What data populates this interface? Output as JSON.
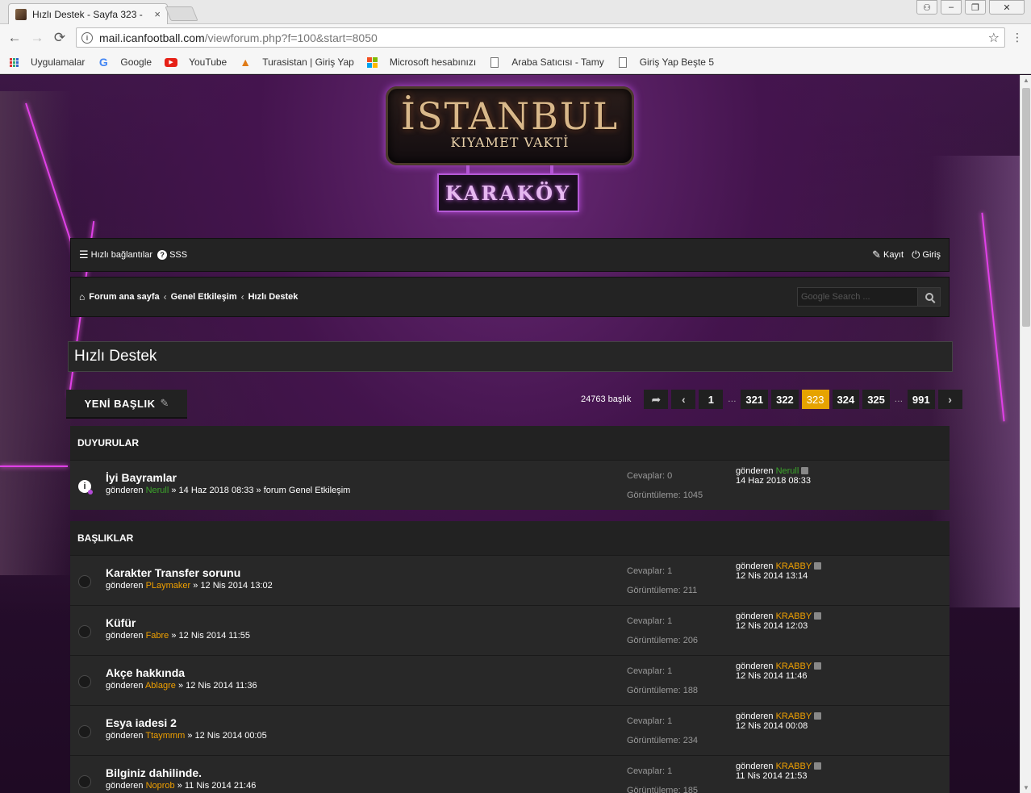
{
  "browser": {
    "tab_title": "Hızlı Destek - Sayfa 323 -",
    "tab_close": "×",
    "url_host": "mail.icanfootball.com",
    "url_path": "/viewforum.php?f=100&start=8050",
    "window_buttons": {
      "user": "⚇",
      "minimize": "–",
      "restore": "❐",
      "close": "✕"
    },
    "nav": {
      "back": "←",
      "forward": "→",
      "reload": "⟳"
    },
    "bookmarks": [
      {
        "label": "Uygulamalar",
        "icon": "apps-grid-icon"
      },
      {
        "label": "Google",
        "icon": "google-icon"
      },
      {
        "label": "YouTube",
        "icon": "youtube-icon"
      },
      {
        "label": "Turasistan | Giriş Yap",
        "icon": "turasistan-icon"
      },
      {
        "label": "Microsoft hesabınızı",
        "icon": "microsoft-icon"
      },
      {
        "label": "Araba Satıcısı - Tamy",
        "icon": "document-icon"
      },
      {
        "label": "Giriş Yap Beşte 5",
        "icon": "document-icon"
      }
    ]
  },
  "logo": {
    "title": "İSTANBUL",
    "subtitle": "KIYAMET VAKTİ",
    "plate": "KARAKÖY"
  },
  "navbar": {
    "quick_links": "Hızlı bağlantılar",
    "faq": "SSS",
    "register": "Kayıt",
    "login": "Giriş"
  },
  "breadcrumbs": {
    "home": "Forum ana sayfa",
    "items": [
      "Genel Etkileşim",
      "Hızlı Destek"
    ],
    "search_placeholder": "Google Search ..."
  },
  "forum": {
    "title": "Hızlı Destek",
    "new_topic": "YENİ BAŞLIK"
  },
  "pagination": {
    "count": "24763 başlık",
    "pages": [
      "1",
      "321",
      "322",
      "323",
      "324",
      "325",
      "991"
    ],
    "active": "323",
    "ellipsis": "…"
  },
  "announcements": {
    "heading": "DUYURULAR",
    "items": [
      {
        "title": "İyi Bayramlar",
        "by": "gönderen",
        "author": "Nerull",
        "date": "» 14 Haz 2018 08:33 » forum Genel Etkileşim",
        "replies": "Cevaplar: 0",
        "views": "Görüntüleme: 1045",
        "last_by": "gönderen",
        "last_author": "Nerull",
        "last_date": "14 Haz 2018 08:33"
      }
    ]
  },
  "topics": {
    "heading": "BAŞLIKLAR",
    "items": [
      {
        "title": "Karakter Transfer sorunu",
        "by": "gönderen",
        "author": "PLaymaker",
        "date": "» 12 Nis 2014 13:02",
        "replies": "Cevaplar: 1",
        "views": "Görüntüleme: 211",
        "last_by": "gönderen",
        "last_author": "KRABBY",
        "last_date": "12 Nis 2014 13:14"
      },
      {
        "title": "Küfür",
        "by": "gönderen",
        "author": "Fabre",
        "date": "» 12 Nis 2014 11:55",
        "replies": "Cevaplar: 1",
        "views": "Görüntüleme: 206",
        "last_by": "gönderen",
        "last_author": "KRABBY",
        "last_date": "12 Nis 2014 12:03"
      },
      {
        "title": "Akçe hakkında",
        "by": "gönderen",
        "author": "Ablagre",
        "date": "» 12 Nis 2014 11:36",
        "replies": "Cevaplar: 1",
        "views": "Görüntüleme: 188",
        "last_by": "gönderen",
        "last_author": "KRABBY",
        "last_date": "12 Nis 2014 11:46"
      },
      {
        "title": "Esya iadesi 2",
        "by": "gönderen",
        "author": "Ttaymmm",
        "date": "» 12 Nis 2014 00:05",
        "replies": "Cevaplar: 1",
        "views": "Görüntüleme: 234",
        "last_by": "gönderen",
        "last_author": "KRABBY",
        "last_date": "12 Nis 2014 00:08"
      },
      {
        "title": "Bilginiz dahilinde.",
        "by": "gönderen",
        "author": "Noprob",
        "date": "» 11 Nis 2014 21:46",
        "replies": "Cevaplar: 1",
        "views": "Görüntüleme: 185",
        "last_by": "gönderen",
        "last_author": "KRABBY",
        "last_date": "11 Nis 2014 21:53"
      }
    ]
  },
  "colors": {
    "accent_active_page": "#e6a300",
    "author_green": "#3ca52c",
    "author_orange": "#f0a000",
    "neon_purple": "#e040e8"
  }
}
